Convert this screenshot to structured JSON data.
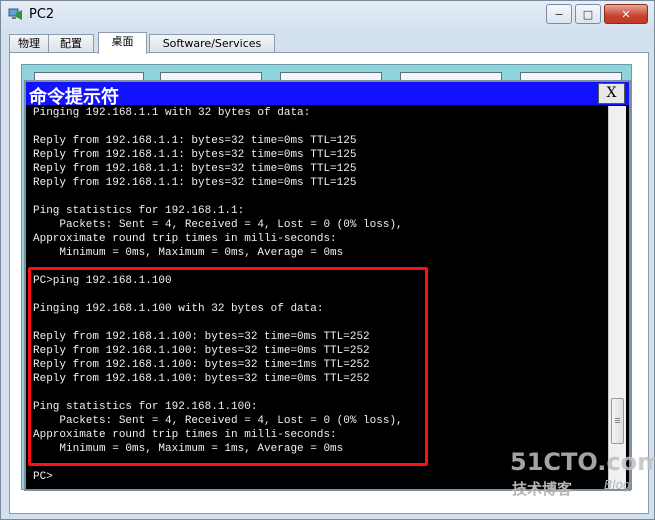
{
  "window": {
    "title": "PC2",
    "min_label": "−",
    "max_label": "□",
    "close_label": "✕"
  },
  "tabs": [
    {
      "label": "物理"
    },
    {
      "label": "配置"
    },
    {
      "label": "桌面"
    },
    {
      "label": "Software/Services"
    }
  ],
  "cmd": {
    "title": "命令提示符",
    "close_label": "X",
    "lines": [
      "Pinging 192.168.1.1 with 32 bytes of data:",
      "",
      "Reply from 192.168.1.1: bytes=32 time=0ms TTL=125",
      "Reply from 192.168.1.1: bytes=32 time=0ms TTL=125",
      "Reply from 192.168.1.1: bytes=32 time=0ms TTL=125",
      "Reply from 192.168.1.1: bytes=32 time=0ms TTL=125",
      "",
      "Ping statistics for 192.168.1.1:",
      "    Packets: Sent = 4, Received = 4, Lost = 0 (0% loss),",
      "Approximate round trip times in milli-seconds:",
      "    Minimum = 0ms, Maximum = 0ms, Average = 0ms",
      "",
      "PC>ping 192.168.1.100",
      "",
      "Pinging 192.168.1.100 with 32 bytes of data:",
      "",
      "Reply from 192.168.1.100: bytes=32 time=0ms TTL=252",
      "Reply from 192.168.1.100: bytes=32 time=0ms TTL=252",
      "Reply from 192.168.1.100: bytes=32 time=1ms TTL=252",
      "Reply from 192.168.1.100: bytes=32 time=0ms TTL=252",
      "",
      "Ping statistics for 192.168.1.100:",
      "    Packets: Sent = 4, Received = 4, Lost = 0 (0% loss),",
      "Approximate round trip times in milli-seconds:",
      "    Minimum = 0ms, Maximum = 1ms, Average = 0ms",
      "",
      "PC>"
    ]
  },
  "watermark": {
    "main": "51CTO.com",
    "sub": "技术博客",
    "blog": "Blog"
  },
  "colors": {
    "highlight": "#ff1010",
    "cmd_title_bg": "#1212ff",
    "desktop_bg": "#8fd3dc"
  }
}
